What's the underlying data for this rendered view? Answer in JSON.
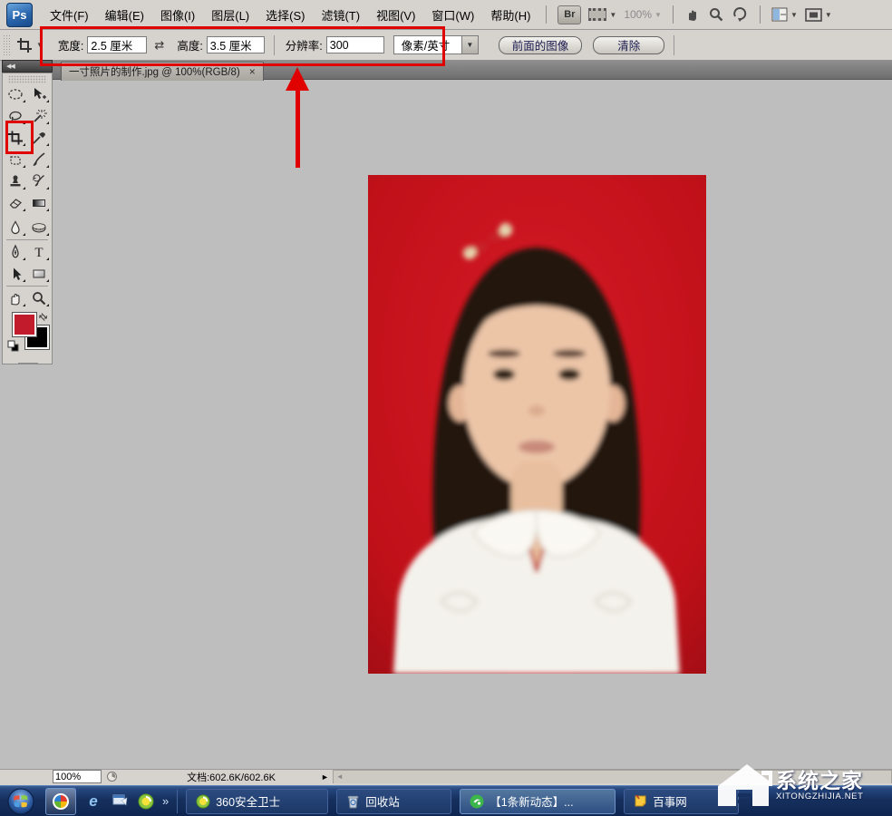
{
  "app": {
    "logo": "Ps"
  },
  "menubar": {
    "items": [
      "文件(F)",
      "编辑(E)",
      "图像(I)",
      "图层(L)",
      "选择(S)",
      "滤镜(T)",
      "视图(V)",
      "窗口(W)",
      "帮助(H)"
    ],
    "bridge": "Br",
    "zoom": "100%"
  },
  "glyphs": {
    "dropdown": "▼",
    "swap": "⇄",
    "collapse": "◀◀",
    "chevron": "»",
    "menu_play": "►",
    "scroll_left": "◄",
    "close": "×"
  },
  "options_bar": {
    "width_label": "宽度:",
    "width_value": "2.5 厘米",
    "height_label": "高度:",
    "height_value": "3.5 厘米",
    "resolution_label": "分辨率:",
    "resolution_value": "300",
    "unit_value": "像素/英寸",
    "front_image_button": "前面的图像",
    "clear_button": "清除"
  },
  "document_tab": {
    "title": "一寸照片的制作.jpg @ 100%(RGB/8)"
  },
  "tools": [
    "elliptical-marquee",
    "move",
    "lasso",
    "magic-wand",
    "crop",
    "eyedropper",
    "spot-healing",
    "brush",
    "clone-stamp",
    "history-brush",
    "eraser",
    "gradient",
    "blur",
    "sponge",
    "pen",
    "type",
    "path-selection",
    "rectangle",
    "hand",
    "zoom"
  ],
  "colors": {
    "foreground": "#c21b2b",
    "background": "#000000",
    "annotation": "#e00000",
    "photo_background": "#c41520"
  },
  "status_bar": {
    "zoom": "100%",
    "doc_info": "文档:602.6K/602.6K"
  },
  "taskbar": {
    "ie": "e",
    "buttons": [
      "360安全卫士",
      "回收站",
      "【1条新动态】...",
      "百事网"
    ]
  },
  "watermark": {
    "title": "系统之家",
    "subtitle": "XITONGZHIJIA.NET"
  }
}
